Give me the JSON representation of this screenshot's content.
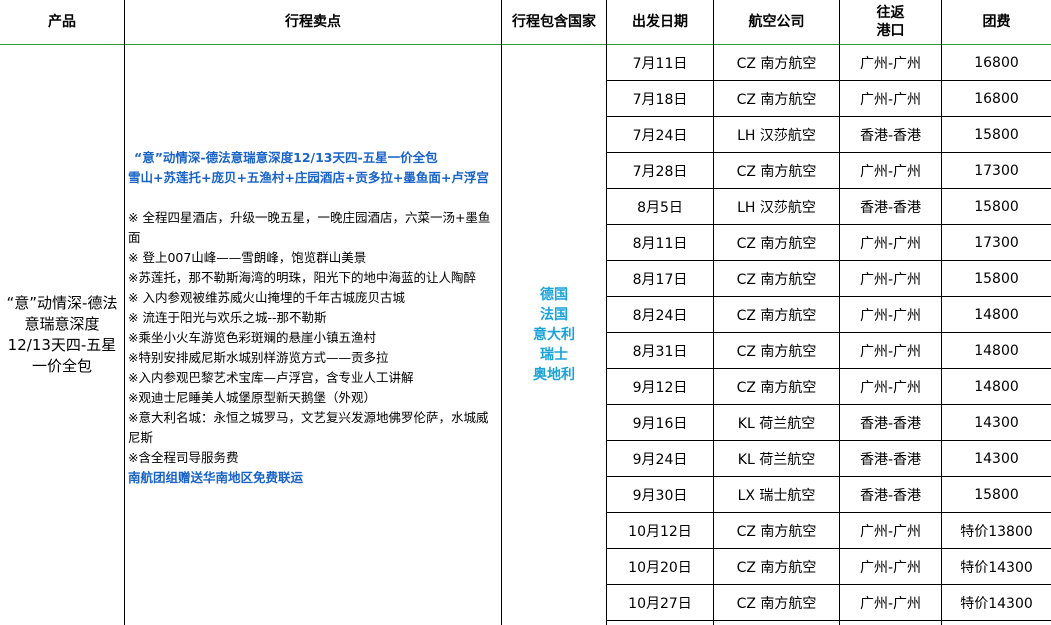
{
  "headers": {
    "product": "产品",
    "highlights": "行程卖点",
    "countries": "行程包含国家",
    "date": "出发日期",
    "airline": "航空公司",
    "port_line1": "往返",
    "port_line2": "港口",
    "price": "团费"
  },
  "product": "“意”动情深-德法意瑞意深度12/13天四-五星一价全包",
  "countries": [
    "德国",
    "法国",
    "意大利",
    "瑞士",
    "奥地利"
  ],
  "highlights": {
    "title": "“意”动情深-德法意瑞意深度12/13天四-五星一价全包",
    "subtitle": "雪山+苏莲托+庞贝+五渔村+庄园酒店+贡多拉+墨鱼面+卢浮宫",
    "items": [
      "※ 全程四星酒店，升级一晚五星，一晚庄园酒店，六菜一汤+墨鱼面",
      "※ 登上007山峰——雪朗峰，饱览群山美景",
      "※苏莲托，那不勒斯海湾的明珠，阳光下的地中海蓝的让人陶醉",
      "※ 入内参观被维苏威火山掩埋的千年古城庞贝古城",
      "※ 流连于阳光与欢乐之城--那不勒斯",
      "※乘坐小火车游览色彩斑斓的悬崖小镇五渔村",
      "※特别安排威尼斯水城别样游览方式——贡多拉",
      "※入内参观巴黎艺术宝库—卢浮宫，含专业人工讲解",
      "※观迪士尼睡美人城堡原型新天鹅堡（外观）",
      "※意大利名城：永恒之城罗马，文艺复兴发源地佛罗伦萨，水城威尼斯",
      "※含全程司导服务费"
    ],
    "footer": "南航团组赠送华南地区免费联运"
  },
  "departures": [
    {
      "date": "7月11日",
      "airline": "CZ 南方航空",
      "port": "广州-广州",
      "price": "16800"
    },
    {
      "date": "7月18日",
      "airline": "CZ 南方航空",
      "port": "广州-广州",
      "price": "16800"
    },
    {
      "date": "7月24日",
      "airline": "LH 汉莎航空",
      "port": "香港-香港",
      "price": "15800"
    },
    {
      "date": "7月28日",
      "airline": "CZ 南方航空",
      "port": "广州-广州",
      "price": "17300"
    },
    {
      "date": "8月5日",
      "airline": "LH 汉莎航空",
      "port": "香港-香港",
      "price": "15800"
    },
    {
      "date": "8月11日",
      "airline": "CZ 南方航空",
      "port": "广州-广州",
      "price": "17300"
    },
    {
      "date": "8月17日",
      "airline": "CZ 南方航空",
      "port": "广州-广州",
      "price": "15800"
    },
    {
      "date": "8月24日",
      "airline": "CZ 南方航空",
      "port": "广州-广州",
      "price": "14800"
    },
    {
      "date": "8月31日",
      "airline": "CZ 南方航空",
      "port": "广州-广州",
      "price": "14800"
    },
    {
      "date": "9月12日",
      "airline": "CZ 南方航空",
      "port": "广州-广州",
      "price": "14800"
    },
    {
      "date": "9月16日",
      "airline": "KL 荷兰航空",
      "port": "香港-香港",
      "price": "14300"
    },
    {
      "date": "9月24日",
      "airline": "KL 荷兰航空",
      "port": "香港-香港",
      "price": "14300"
    },
    {
      "date": "9月30日",
      "airline": "LX 瑞士航空",
      "port": "香港-香港",
      "price": "15800"
    },
    {
      "date": "10月12日",
      "airline": "CZ 南方航空",
      "port": "广州-广州",
      "price": "特价13800"
    },
    {
      "date": "10月20日",
      "airline": "CZ 南方航空",
      "port": "广州-广州",
      "price": "特价14300"
    },
    {
      "date": "10月27日",
      "airline": "CZ 南方航空",
      "port": "广州-广州",
      "price": "特价14300"
    }
  ],
  "colors": {
    "header_rule": "#3a9a3a",
    "countries_text": "#1aa3d9",
    "highlight_text": "#1a63c8"
  }
}
